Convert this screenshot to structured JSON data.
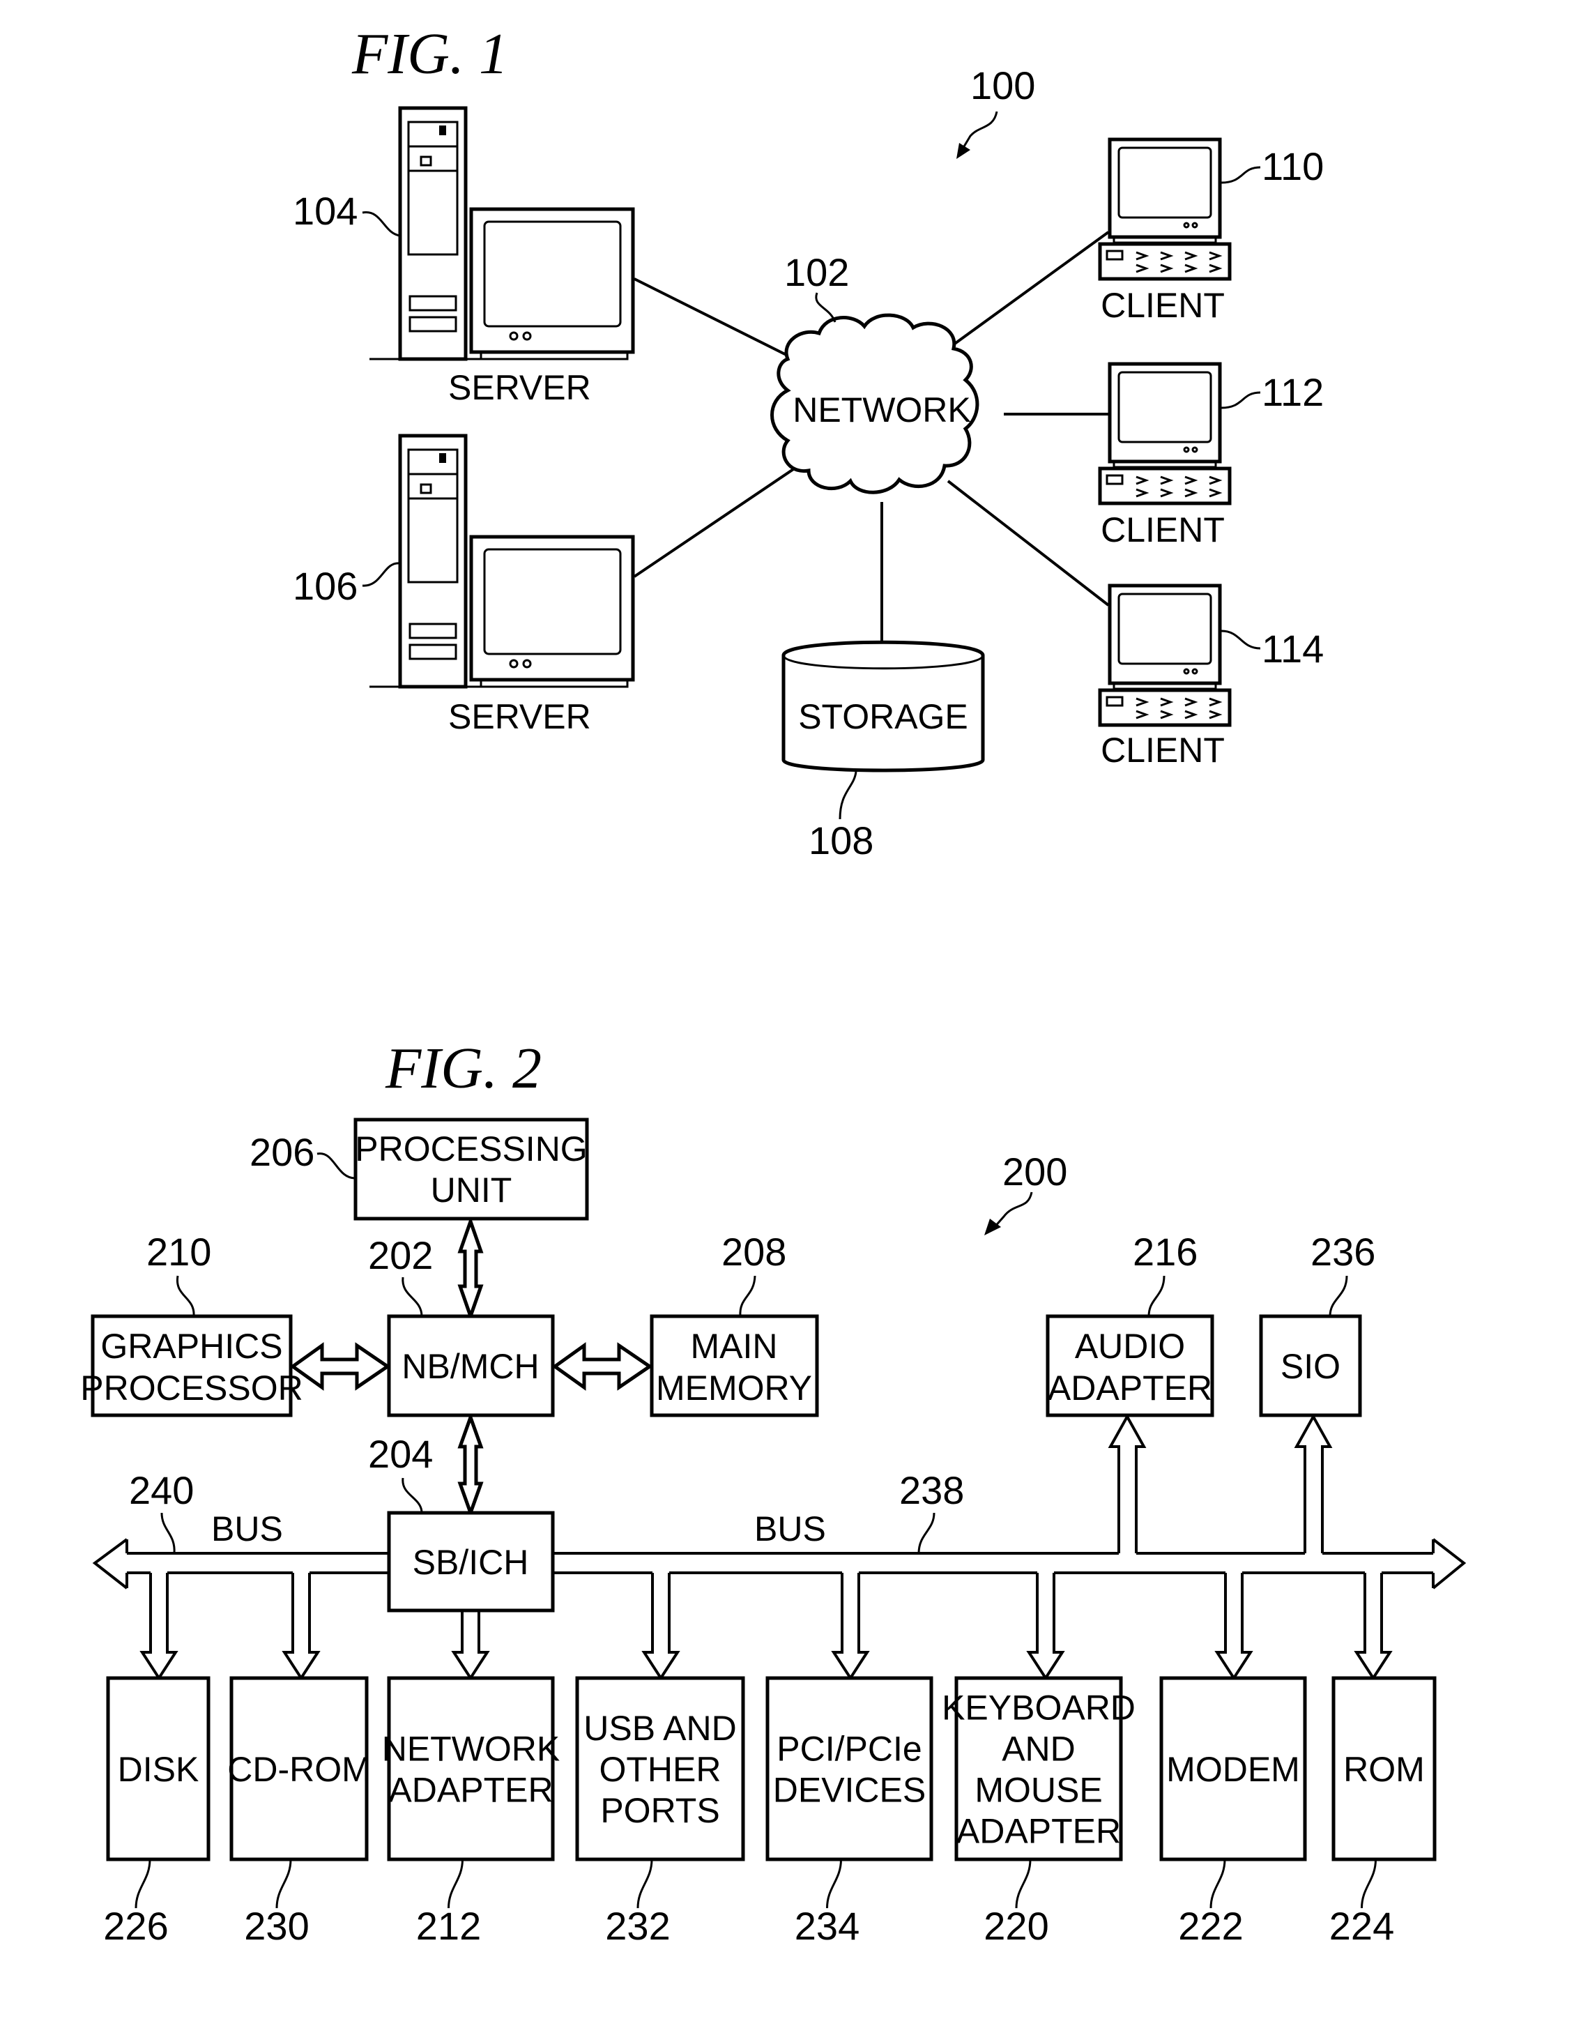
{
  "fig1": {
    "title": "FIG. 1",
    "system_ref": "100",
    "network": {
      "label": "NETWORK",
      "ref": "102"
    },
    "storage": {
      "label": "STORAGE",
      "ref": "108"
    },
    "servers": [
      {
        "label": "SERVER",
        "ref": "104"
      },
      {
        "label": "SERVER",
        "ref": "106"
      }
    ],
    "clients": [
      {
        "label": "CLIENT",
        "ref": "110"
      },
      {
        "label": "CLIENT",
        "ref": "112"
      },
      {
        "label": "CLIENT",
        "ref": "114"
      }
    ]
  },
  "fig2": {
    "title": "FIG. 2",
    "system_ref": "200",
    "processing_unit": {
      "lines": [
        "PROCESSING",
        "UNIT"
      ],
      "ref": "206"
    },
    "nb_mch": {
      "lines": [
        "NB/MCH"
      ],
      "ref": "202"
    },
    "graphics": {
      "lines": [
        "GRAPHICS",
        "PROCESSOR"
      ],
      "ref": "210"
    },
    "main_memory": {
      "lines": [
        "MAIN",
        "MEMORY"
      ],
      "ref": "208"
    },
    "sb_ich": {
      "lines": [
        "SB/ICH"
      ],
      "ref": "204"
    },
    "audio": {
      "lines": [
        "AUDIO",
        "ADAPTER"
      ],
      "ref": "216"
    },
    "sio": {
      "lines": [
        "SIO"
      ],
      "ref": "236"
    },
    "bus_left": {
      "label": "BUS",
      "ref": "240"
    },
    "bus_right": {
      "label": "BUS",
      "ref": "238"
    },
    "devices": [
      {
        "lines": [
          "DISK"
        ],
        "ref": "226"
      },
      {
        "lines": [
          "CD-ROM"
        ],
        "ref": "230"
      },
      {
        "lines": [
          "NETWORK",
          "ADAPTER"
        ],
        "ref": "212"
      },
      {
        "lines": [
          "USB AND",
          "OTHER",
          "PORTS"
        ],
        "ref": "232"
      },
      {
        "lines": [
          "PCI/PCIe",
          "DEVICES"
        ],
        "ref": "234"
      },
      {
        "lines": [
          "KEYBOARD",
          "AND",
          "MOUSE",
          "ADAPTER"
        ],
        "ref": "220"
      },
      {
        "lines": [
          "MODEM"
        ],
        "ref": "222"
      },
      {
        "lines": [
          "ROM"
        ],
        "ref": "224"
      }
    ]
  }
}
